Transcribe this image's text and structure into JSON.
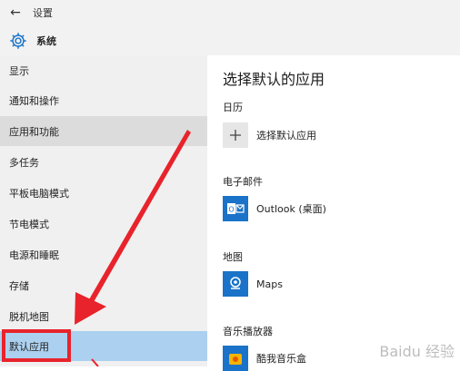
{
  "titlebar": {
    "back_icon": "back-arrow-icon",
    "title": "设置"
  },
  "header": {
    "icon": "gear-icon",
    "title": "系统"
  },
  "sidebar": {
    "items": [
      {
        "label": "显示"
      },
      {
        "label": "通知和操作"
      },
      {
        "label": "应用和功能",
        "state": "hover"
      },
      {
        "label": "多任务"
      },
      {
        "label": "平板电脑模式"
      },
      {
        "label": "节电模式"
      },
      {
        "label": "电源和睡眠"
      },
      {
        "label": "存储"
      },
      {
        "label": "脱机地图"
      },
      {
        "label": "默认应用",
        "state": "selected"
      }
    ]
  },
  "main": {
    "title": "选择默认的应用",
    "sections": [
      {
        "label": "日历",
        "app": "选择默认应用",
        "icon": "plus-icon"
      },
      {
        "label": "电子邮件",
        "app": "Outlook (桌面)",
        "icon": "outlook-icon"
      },
      {
        "label": "地图",
        "app": "Maps",
        "icon": "maps-icon"
      },
      {
        "label": "音乐播放器",
        "app": "酷我音乐盒",
        "icon": "kuwo-music-icon"
      }
    ]
  },
  "colors": {
    "accent_blue": "#1a73c8",
    "selected_bg": "#acd0ef",
    "annotation_red": "#e8232b",
    "sidebar_bg": "#f0f0f0"
  },
  "watermark": {
    "text": "Baidu 经验"
  }
}
